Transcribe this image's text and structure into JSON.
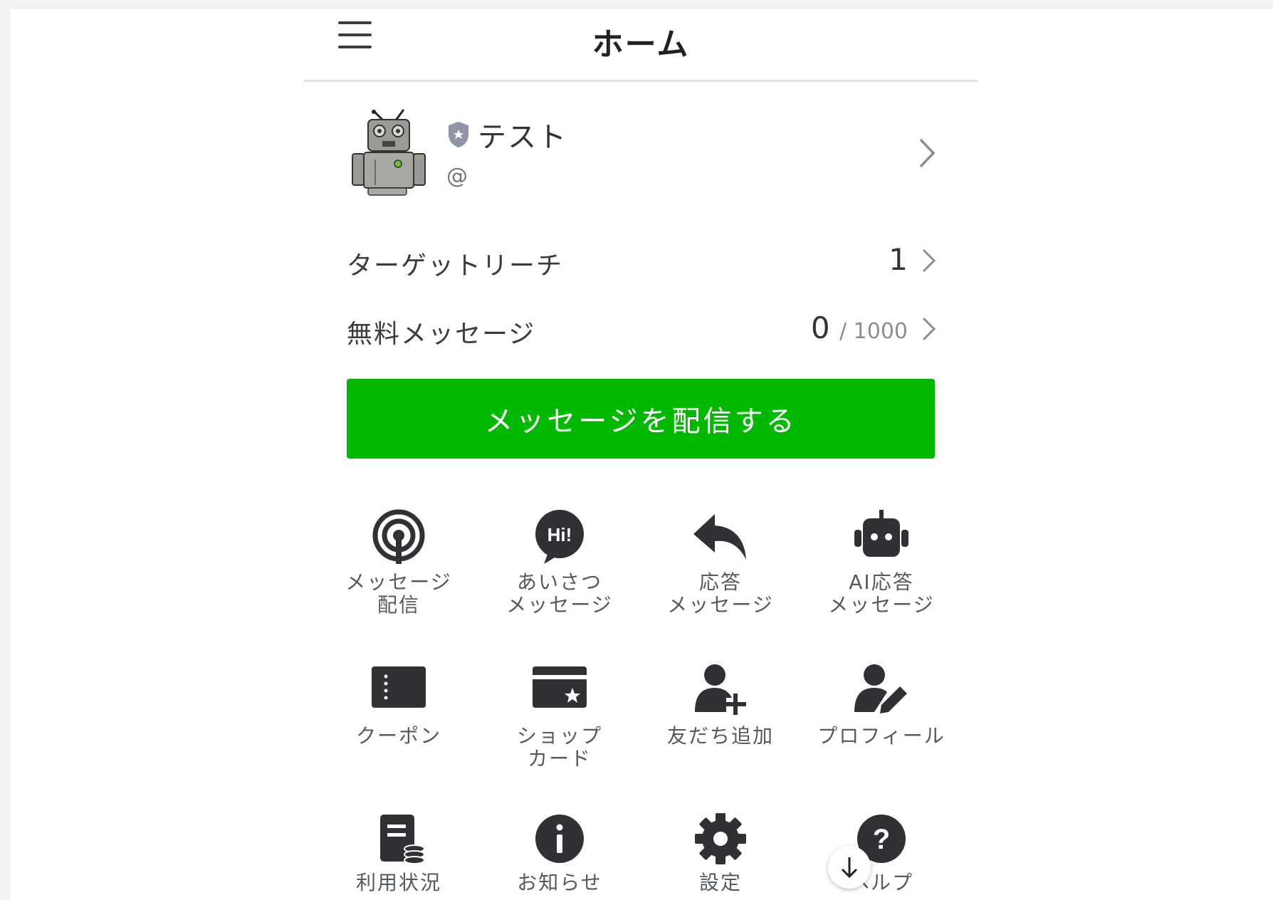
{
  "header": {
    "title": "ホーム",
    "menu_icon": "hamburger-icon"
  },
  "account": {
    "name": "テスト",
    "id": "@",
    "badge_icon": "shield-icon",
    "avatar_icon": "robot-avatar"
  },
  "stats": [
    {
      "label": "ターゲットリーチ",
      "value": "1",
      "suffix": ""
    },
    {
      "label": "無料メッセージ",
      "value": "0",
      "suffix": "/ 1000"
    }
  ],
  "send_button": {
    "label": "メッセージを配信する",
    "color": "#00b900"
  },
  "menu_grid": [
    {
      "icon": "broadcast-icon",
      "label": "メッセージ\n配信"
    },
    {
      "icon": "greeting-hi-icon",
      "label": "あいさつ\nメッセージ"
    },
    {
      "icon": "reply-arrow-icon",
      "label": "応答\nメッセージ"
    },
    {
      "icon": "robot-icon",
      "label": "AI応答\nメッセージ"
    },
    {
      "icon": "coupon-icon",
      "label": "クーポン"
    },
    {
      "icon": "shop-card-icon",
      "label": "ショップ\nカード"
    },
    {
      "icon": "add-friend-icon",
      "label": "友だち追加"
    },
    {
      "icon": "profile-edit-icon",
      "label": "プロフィール"
    },
    {
      "icon": "usage-document-icon",
      "label": "利用状況"
    },
    {
      "icon": "info-icon",
      "label": "お知らせ"
    },
    {
      "icon": "gear-icon",
      "label": "設定"
    },
    {
      "icon": "help-icon",
      "label": "ヘルプ"
    }
  ],
  "scroll_button": {
    "icon": "arrow-down-icon"
  }
}
